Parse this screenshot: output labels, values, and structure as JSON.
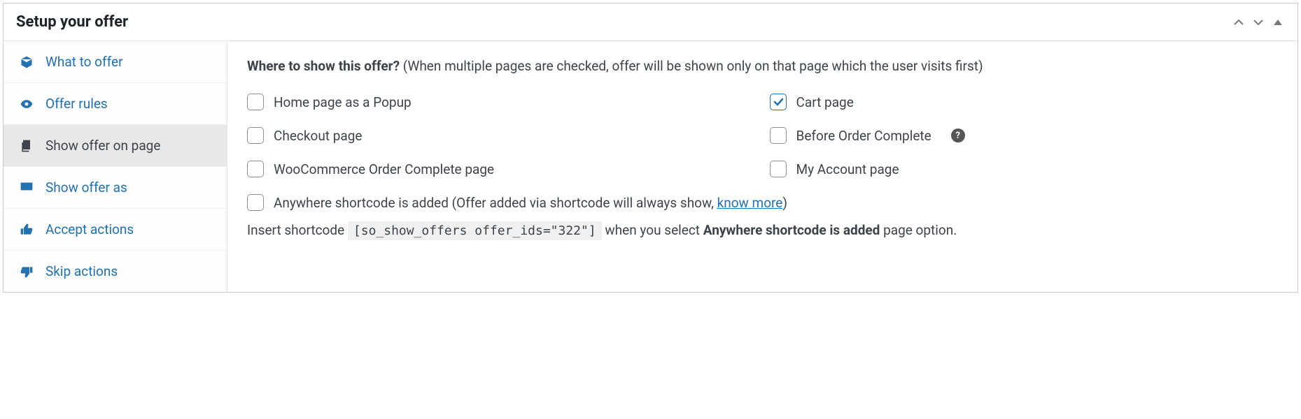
{
  "panel": {
    "title": "Setup your offer"
  },
  "sidebar": {
    "items": [
      {
        "label": "What to offer"
      },
      {
        "label": "Offer rules"
      },
      {
        "label": "Show offer on page"
      },
      {
        "label": "Show offer as"
      },
      {
        "label": "Accept actions"
      },
      {
        "label": "Skip actions"
      }
    ]
  },
  "main": {
    "heading_strong": "Where to show this offer?",
    "heading_note": "(When multiple pages are checked, offer will be shown only on that page which the user visits first)",
    "options": {
      "home_popup": "Home page as a Popup",
      "cart_page": "Cart page",
      "checkout": "Checkout page",
      "before_order": "Before Order Complete",
      "woo_complete": "WooCommerce Order Complete page",
      "my_account": "My Account page"
    },
    "anywhere": {
      "label": "Anywhere shortcode is added",
      "note_pre": "(Offer added via shortcode will always show, ",
      "link": "know more",
      "note_post": ")"
    },
    "shortcode": {
      "pre": "Insert shortcode ",
      "code": "[so_show_offers offer_ids=\"322\"]",
      "mid": " when you select ",
      "bold": "Anywhere shortcode is added",
      "post": " page option."
    }
  }
}
